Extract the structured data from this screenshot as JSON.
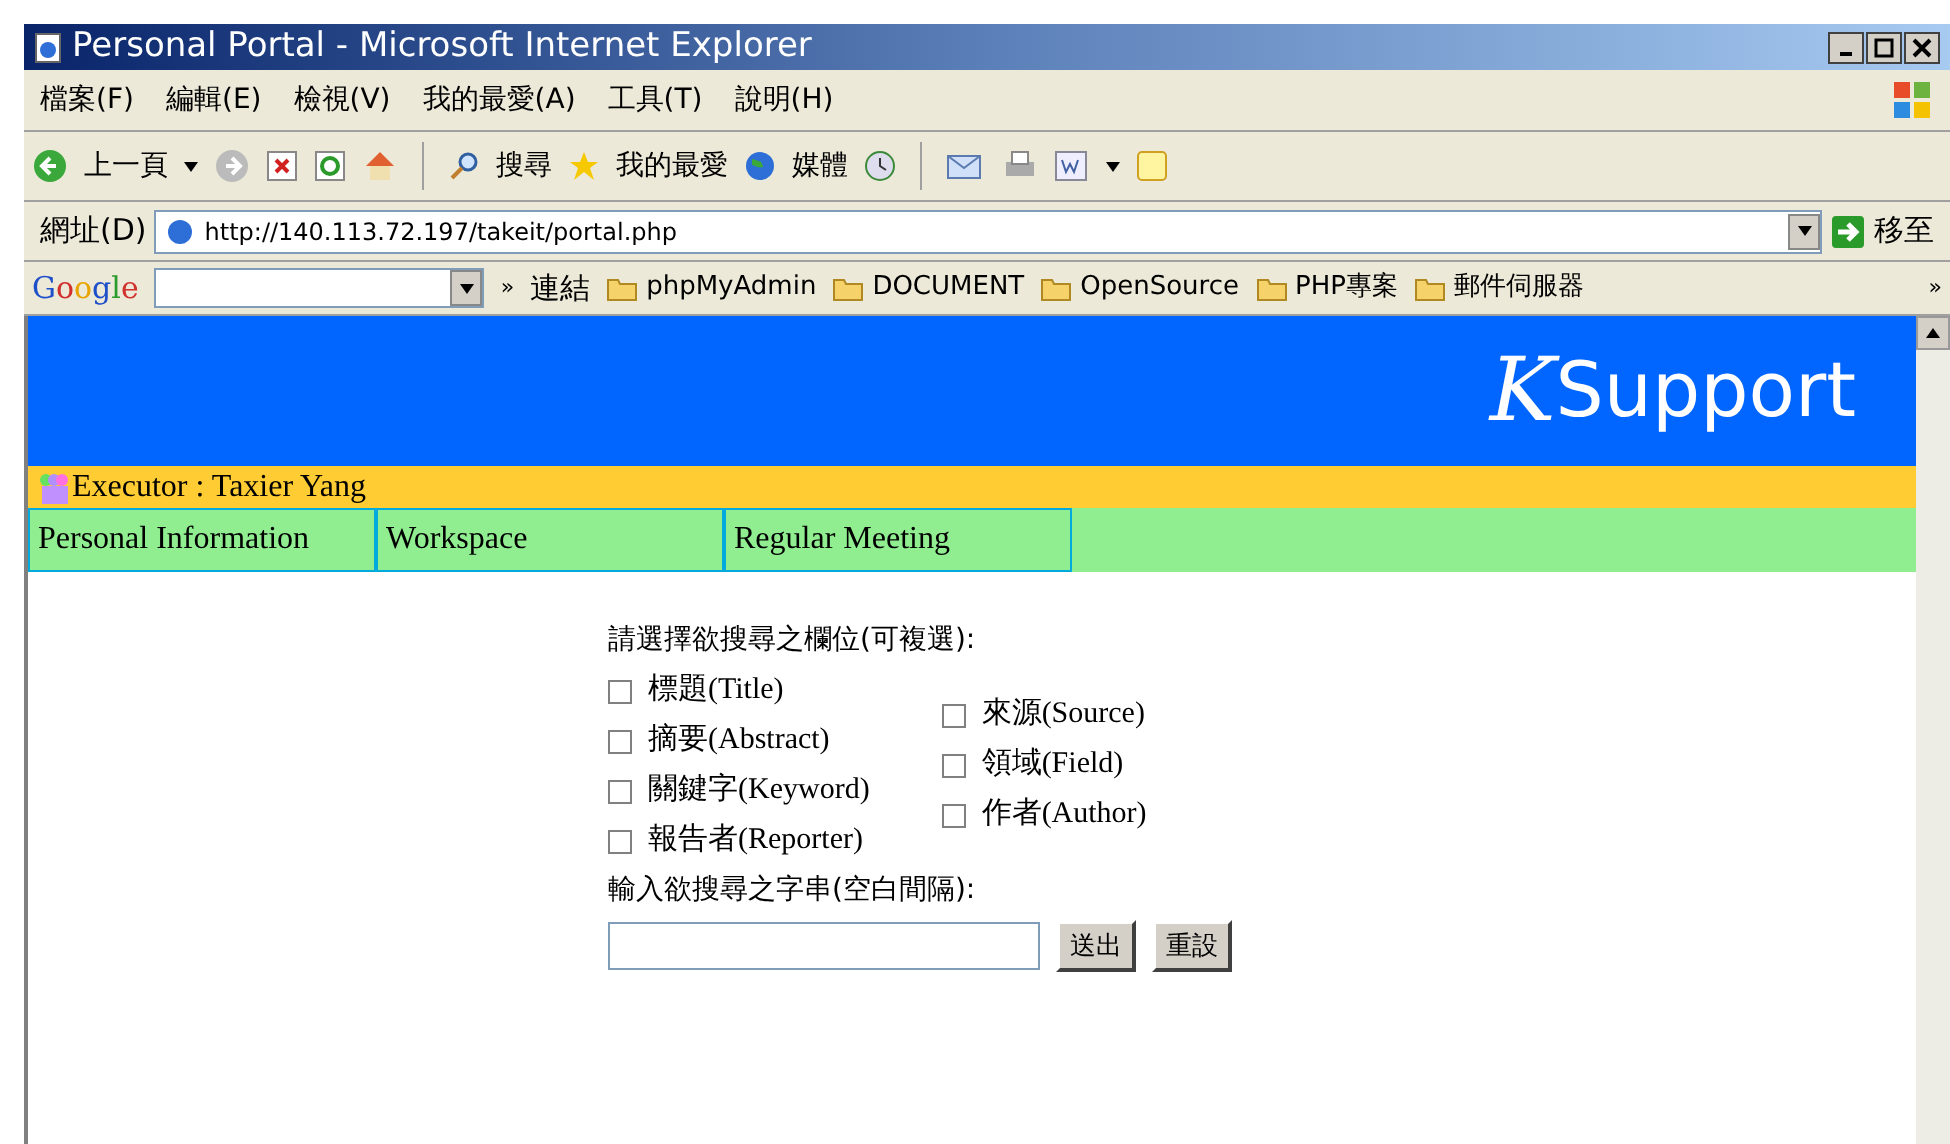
{
  "window": {
    "title": "Personal Portal - Microsoft Internet Explorer"
  },
  "menu": [
    "檔案(F)",
    "編輯(E)",
    "檢視(V)",
    "我的最愛(A)",
    "工具(T)",
    "說明(H)"
  ],
  "toolbar": {
    "back": "上一頁",
    "search": "搜尋",
    "favorites": "我的最愛",
    "media": "媒體"
  },
  "address": {
    "label": "網址(D)",
    "value": "http://140.113.72.197/takeit/portal.php",
    "go": "移至"
  },
  "links_bar": {
    "google": "Google",
    "chevron": "»",
    "label": "連結",
    "links": [
      "phpMyAdmin",
      "DOCUMENT",
      "OpenSource",
      "PHP專案",
      "郵件伺服器"
    ],
    "more": "»"
  },
  "page": {
    "logo_k": "K",
    "logo_text": "Support",
    "executor": "Executor : Taxier Yang",
    "tabs": [
      "Personal Information",
      "Workspace",
      "Regular Meeting"
    ],
    "prompt": "請選擇欲搜尋之欄位(可複選):",
    "columns": [
      [
        {
          "label": "標題(Title)",
          "checked": false
        },
        {
          "label": "摘要(Abstract)",
          "checked": false
        },
        {
          "label": "關鍵字(Keyword)",
          "checked": false
        },
        {
          "label": "報告者(Reporter)",
          "checked": false
        }
      ],
      [
        {
          "label": "來源(Source)",
          "checked": false
        },
        {
          "label": "領域(Field)",
          "checked": false
        },
        {
          "label": "作者(Author)",
          "checked": false
        }
      ]
    ],
    "query_label": "輸入欲搜尋之字串(空白間隔):",
    "buttons": [
      "送出",
      "重設"
    ]
  }
}
